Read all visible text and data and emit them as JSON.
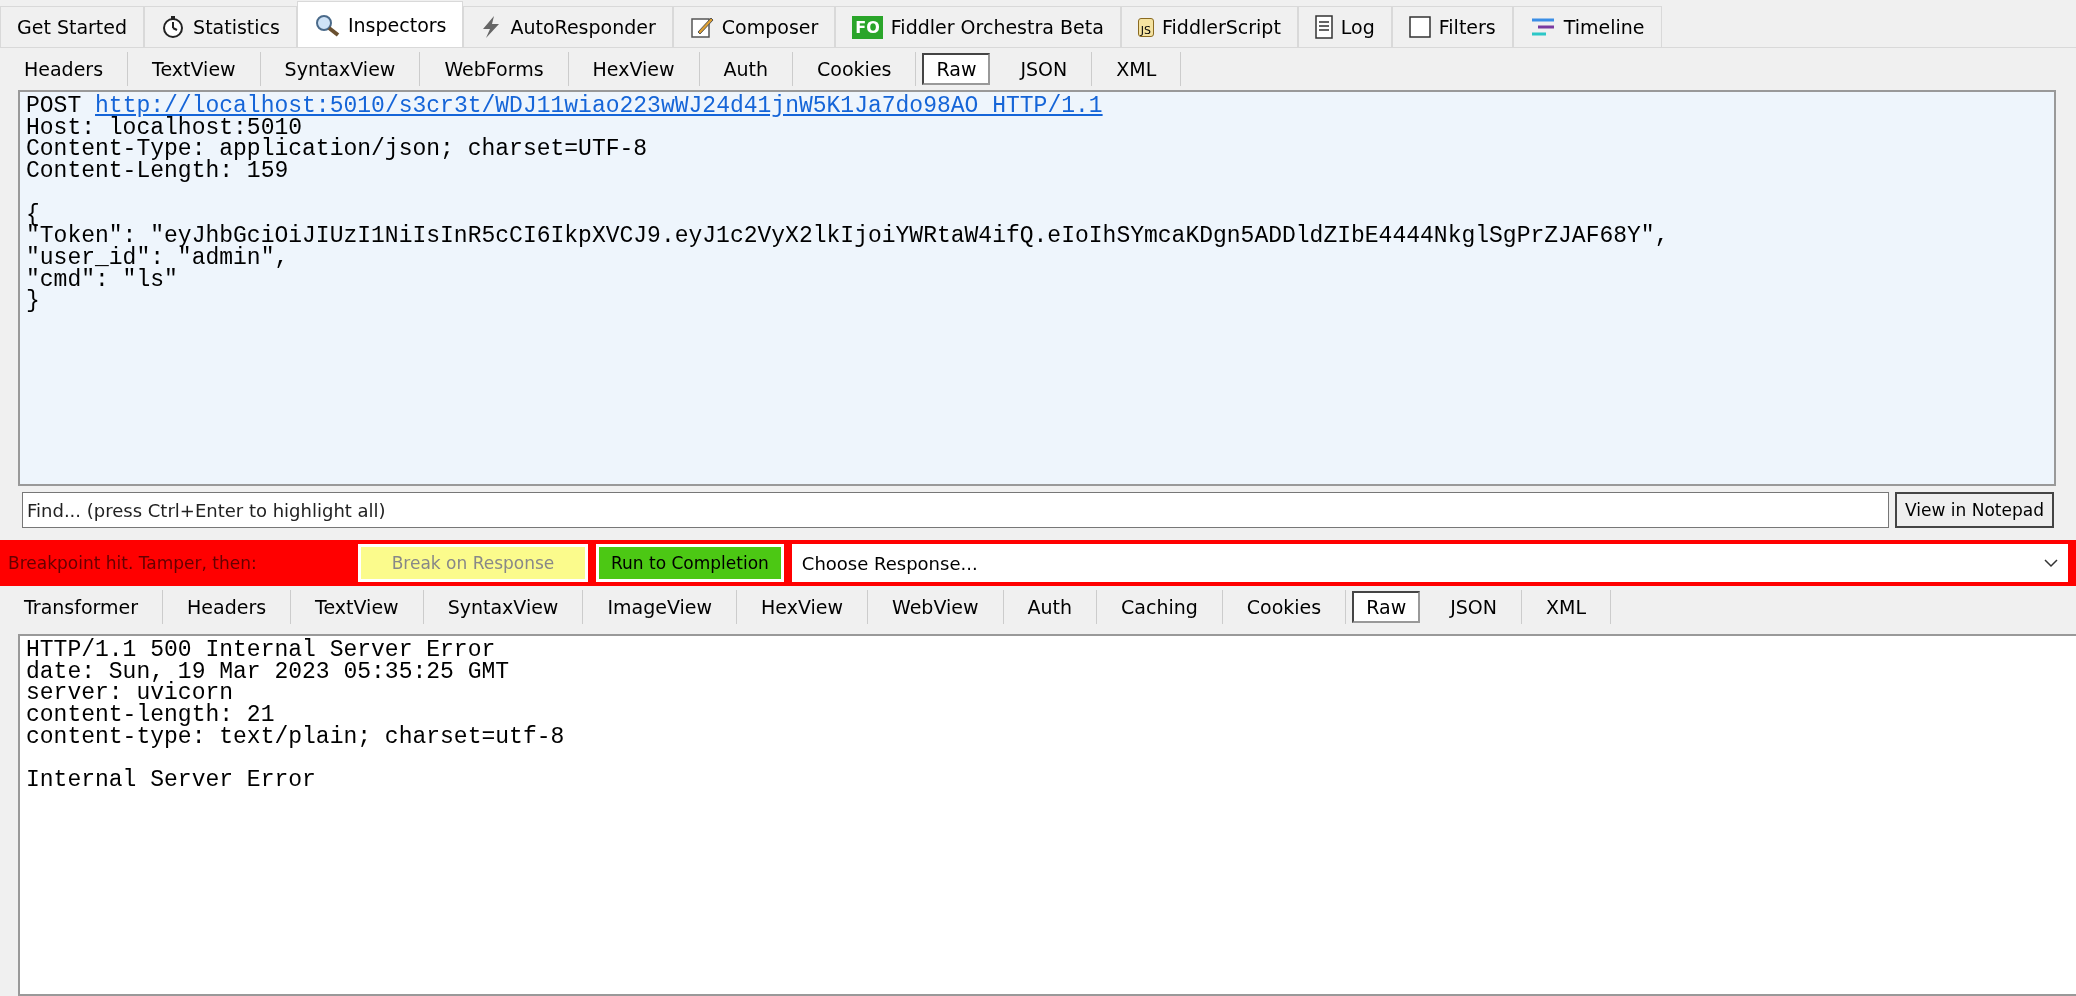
{
  "main_tabs": [
    {
      "label": "Get Started",
      "selected": false
    },
    {
      "label": "Statistics",
      "selected": false
    },
    {
      "label": "Inspectors",
      "selected": true
    },
    {
      "label": "AutoResponder",
      "selected": false
    },
    {
      "label": "Composer",
      "selected": false
    },
    {
      "label": "Fiddler Orchestra Beta",
      "badge": "FO",
      "selected": false
    },
    {
      "label": "FiddlerScript",
      "badge": "JS",
      "selected": false
    },
    {
      "label": "Log",
      "selected": false
    },
    {
      "label": "Filters",
      "selected": false
    },
    {
      "label": "Timeline",
      "selected": false
    }
  ],
  "request": {
    "tabs": [
      {
        "label": "Headers",
        "selected": false
      },
      {
        "label": "TextView",
        "selected": false
      },
      {
        "label": "SyntaxView",
        "selected": false
      },
      {
        "label": "WebForms",
        "selected": false
      },
      {
        "label": "HexView",
        "selected": false
      },
      {
        "label": "Auth",
        "selected": false
      },
      {
        "label": "Cookies",
        "selected": false
      },
      {
        "label": "Raw",
        "selected": true
      },
      {
        "label": "JSON",
        "selected": false
      },
      {
        "label": "XML",
        "selected": false
      }
    ],
    "method": "POST",
    "url": "http://localhost:5010/s3cr3t/WDJ11wiao223wWJ24d41jnW5K1Ja7do98AO HTTP/1.1",
    "header_lines": [
      "Host: localhost:5010",
      "Content-Type: application/json; charset=UTF-8",
      "Content-Length: 159"
    ],
    "body_lines": [
      "{",
      "\"Token\": \"eyJhbGciOiJIUzI1NiIsInR5cCI6IkpXVCJ9.eyJ1c2VyX2lkIjoiYWRtaW4ifQ.eIoIhSYmcaKDgn5ADDldZIbE4444NkglSgPrZJAF68Y\",",
      "\"user_id\": \"admin\",",
      "\"cmd\": \"ls\"",
      "}"
    ],
    "find_placeholder": "Find... (press Ctrl+Enter to highlight all)",
    "notepad_button": "View in Notepad"
  },
  "breakpoint": {
    "message": "Breakpoint hit. Tamper, then:",
    "break_button": "Break on Response",
    "run_button": "Run to Completion",
    "response_dropdown": "Choose Response..."
  },
  "response": {
    "tabs": [
      {
        "label": "Transformer",
        "selected": false
      },
      {
        "label": "Headers",
        "selected": false
      },
      {
        "label": "TextView",
        "selected": false
      },
      {
        "label": "SyntaxView",
        "selected": false
      },
      {
        "label": "ImageView",
        "selected": false
      },
      {
        "label": "HexView",
        "selected": false
      },
      {
        "label": "WebView",
        "selected": false
      },
      {
        "label": "Auth",
        "selected": false
      },
      {
        "label": "Caching",
        "selected": false
      },
      {
        "label": "Cookies",
        "selected": false
      },
      {
        "label": "Raw",
        "selected": true
      },
      {
        "label": "JSON",
        "selected": false
      },
      {
        "label": "XML",
        "selected": false
      }
    ],
    "header_lines": [
      "HTTP/1.1 500 Internal Server Error",
      "date: Sun, 19 Mar 2023 05:35:25 GMT",
      "server: uvicorn",
      "content-length: 21",
      "content-type: text/plain; charset=utf-8"
    ],
    "body_lines": [
      "Internal Server Error"
    ]
  }
}
